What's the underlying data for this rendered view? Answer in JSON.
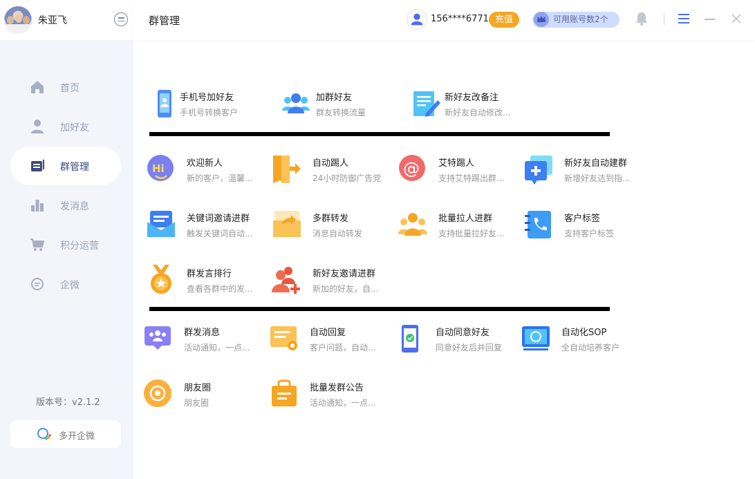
{
  "sidebar": {
    "username": "朱亚飞",
    "nav": [
      {
        "label": "首页",
        "icon": "home-icon"
      },
      {
        "label": "加好友",
        "icon": "person-icon"
      },
      {
        "label": "群管理",
        "icon": "group-manage-icon",
        "active": true
      },
      {
        "label": "发消息",
        "icon": "bar-chart-icon"
      },
      {
        "label": "积分运营",
        "icon": "cart-icon"
      },
      {
        "label": "企微",
        "icon": "chat-bubble-icon"
      }
    ],
    "version": "版本号：v2.1.2",
    "multi_open": "多开企微"
  },
  "header": {
    "title": "群管理",
    "phone": "156****6771",
    "recharge": "充值",
    "accounts": "可用账号数2个"
  },
  "sections": [
    {
      "tiles": [
        {
          "title": "手机号加好友",
          "desc": "手机号转换客户",
          "icon": "phone-contact-icon"
        },
        {
          "title": "加群好友",
          "desc": "群友转换流量",
          "icon": "group-people-icon"
        },
        {
          "title": "新好友改备注",
          "desc": "新好友自动修改...",
          "icon": "edit-note-icon"
        }
      ]
    },
    {
      "tiles": [
        {
          "title": "欢迎新人",
          "desc": "新的客户，温馨...",
          "icon": "hi-icon"
        },
        {
          "title": "自动踢人",
          "desc": "24小时防御广告党",
          "icon": "exit-door-icon"
        },
        {
          "title": "艾特踢人",
          "desc": "支持艾特踢出群...",
          "icon": "at-sign-icon"
        },
        {
          "title": "新好友自动建群",
          "desc": "新增好友达到指...",
          "icon": "add-group-icon"
        },
        {
          "title": "关键词邀请进群",
          "desc": "触发关键词自动...",
          "icon": "mail-invite-icon"
        },
        {
          "title": "多群转发",
          "desc": "消息自动转发",
          "icon": "forward-folder-icon"
        },
        {
          "title": "批量拉人进群",
          "desc": "支持批量拉好友...",
          "icon": "crowd-icon"
        },
        {
          "title": "客户标签",
          "desc": "支持客户标签",
          "icon": "phone-book-icon"
        },
        {
          "title": "群发言排行",
          "desc": "查看各群中的发...",
          "icon": "medal-icon"
        },
        {
          "title": "新好友邀请进群",
          "desc": "新加的好友，自...",
          "icon": "add-friend-icon"
        }
      ]
    },
    {
      "tiles": [
        {
          "title": "群发消息",
          "desc": "活动通知，一点...",
          "icon": "group-message-icon"
        },
        {
          "title": "自动回复",
          "desc": "客户问题，自动...",
          "icon": "auto-reply-icon"
        },
        {
          "title": "自动同意好友",
          "desc": "同意好友后并回复",
          "icon": "accept-friend-icon"
        },
        {
          "title": "自动化SOP",
          "desc": "全自动培养客户",
          "icon": "monitor-sop-icon"
        },
        {
          "title": "朋友圈",
          "desc": "朋友圈",
          "icon": "moments-icon"
        },
        {
          "title": "批量发群公告",
          "desc": "活动通知，一点...",
          "icon": "notice-bag-icon"
        }
      ]
    }
  ],
  "colors": {
    "sidebar_bg": "#f3f5fa",
    "accent_orange": "#f5a623",
    "accent_blue": "#4d8df7",
    "nav_active_text": "#3e4b7b"
  }
}
